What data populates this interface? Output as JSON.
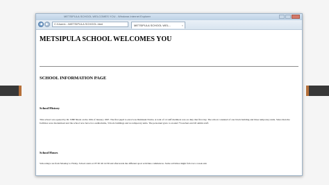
{
  "browser": {
    "window_title": "METSIPULA SCHOOL WELCOMES YOU - Windows Internet Explorer",
    "address": "C:\\Users\\...\\METSIPULA SCHOOL.html",
    "tab_title": "METSIPULA SCHOOL WEL...",
    "tab_close": "×",
    "back_glyph": "◀",
    "forward_glyph": "▶"
  },
  "page": {
    "title": "METSIPULA SCHOOL WELCOMES YOU",
    "subtitle": "SCHOOL INFORMATION PAGE",
    "sections": [
      {
        "heading": "School History",
        "body": "This school was opened by Dr. NHP Nkala on the 16th of January 1997. The first pupil to enrol was Dumisani Ncube. A total of 12 staff members was on duty that first day. The school consisted of one block building and three temporary units. Since then the facilities were modernised and the school now have two auditoriums, 3 block buildings and no temporary units. The personnel grew to around 75 teachers and 20 admin staff."
      },
      {
        "heading": "School Hours",
        "body": "Schooldays are from Monday to Friday. School starts at 07:30 till 14:30 and afterwards the different sport activities commences. Some activities might fall over a week end."
      }
    ]
  },
  "colors": {
    "slide_background": "#f5f5f5",
    "side_bars": "#383838",
    "side_accent": "#b5703a",
    "window_frame": "#9fb4c8"
  }
}
